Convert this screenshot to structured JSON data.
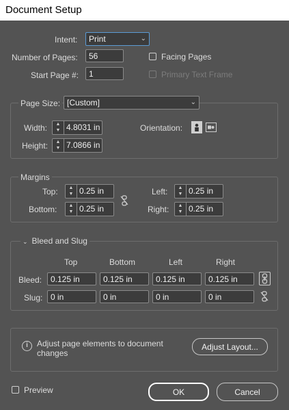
{
  "window": {
    "title": "Document Setup"
  },
  "intent": {
    "label": "Intent:",
    "value": "Print"
  },
  "pages": {
    "label": "Number of Pages:",
    "value": "56"
  },
  "start_page": {
    "label": "Start Page #:",
    "value": "1"
  },
  "facing_pages": {
    "label": "Facing Pages"
  },
  "primary_text_frame": {
    "label": "Primary Text Frame"
  },
  "page_size": {
    "label": "Page Size:",
    "value": "[Custom]",
    "width_label": "Width:",
    "width": "4.8031 in",
    "height_label": "Height:",
    "height": "7.0866 in",
    "orientation_label": "Orientation:"
  },
  "margins": {
    "title": "Margins",
    "top_label": "Top:",
    "top": "0.25 in",
    "bottom_label": "Bottom:",
    "bottom": "0.25 in",
    "left_label": "Left:",
    "left": "0.25 in",
    "right_label": "Right:",
    "right": "0.25 in"
  },
  "bleed_slug": {
    "title": "Bleed and Slug",
    "columns": [
      "Top",
      "Bottom",
      "Left",
      "Right"
    ],
    "bleed_label": "Bleed:",
    "bleed": [
      "0.125 in",
      "0.125 in",
      "0.125 in",
      "0.125 in"
    ],
    "slug_label": "Slug:",
    "slug": [
      "0 in",
      "0 in",
      "0 in",
      "0 in"
    ]
  },
  "info": {
    "text_line1": "Adjust page elements to document",
    "text_line2": "changes",
    "adjust_button": "Adjust Layout..."
  },
  "preview": {
    "label": "Preview"
  },
  "buttons": {
    "ok": "OK",
    "cancel": "Cancel"
  }
}
